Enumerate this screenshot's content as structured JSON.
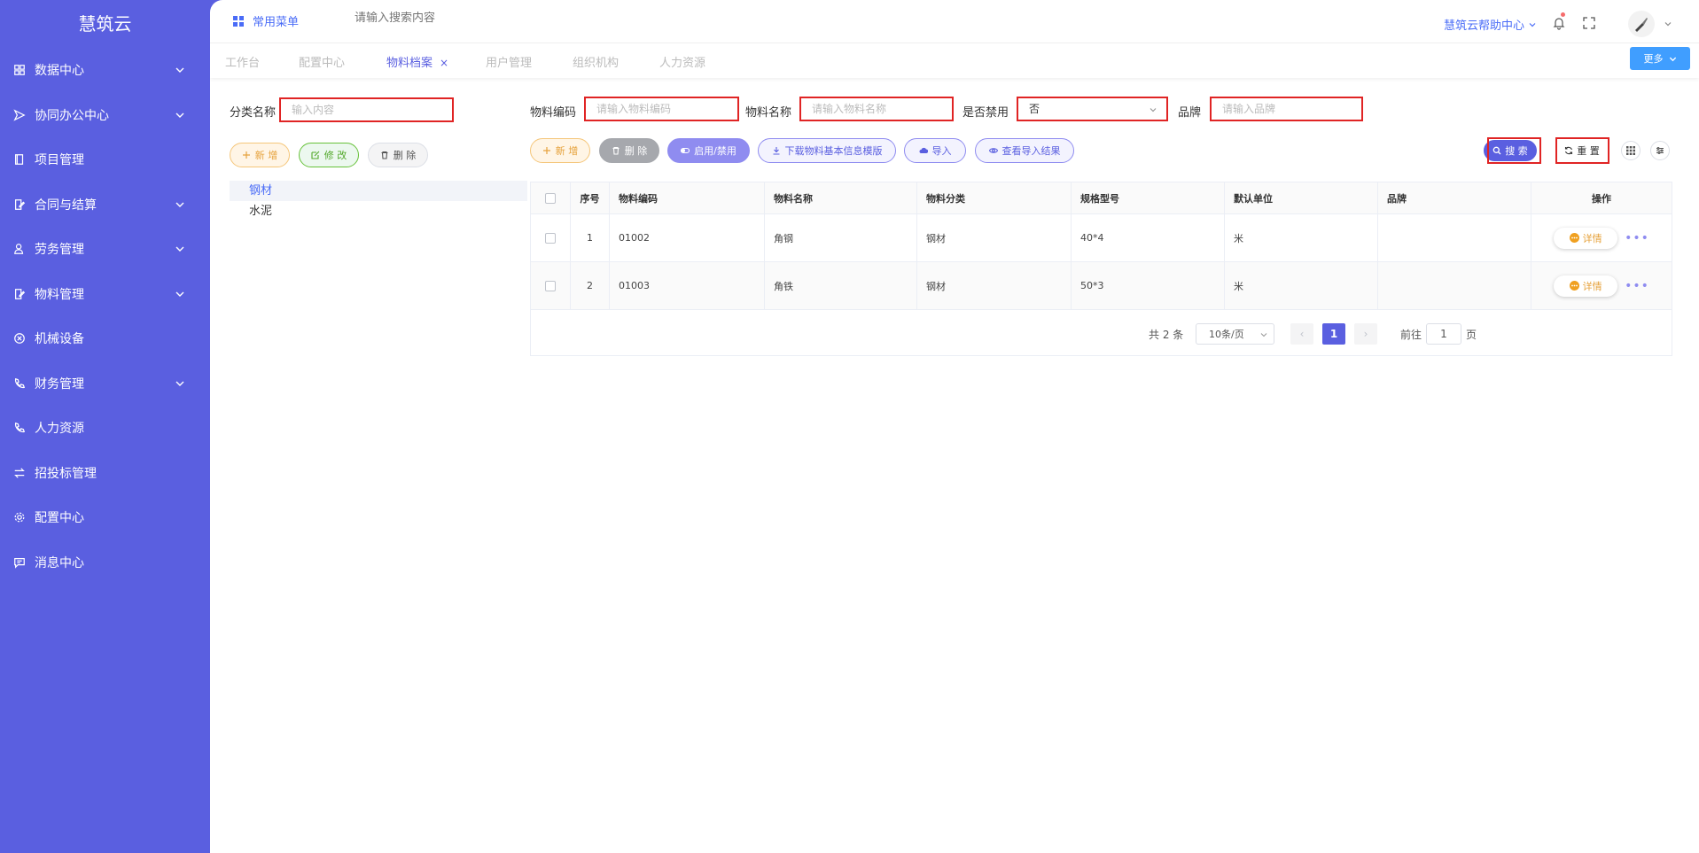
{
  "sidebar": {
    "brand": "慧筑云",
    "items": [
      {
        "label": "数据中心",
        "icon": "dashboard-icon",
        "expandable": true
      },
      {
        "label": "协同办公中心",
        "icon": "send-icon",
        "expandable": true
      },
      {
        "label": "项目管理",
        "icon": "book-icon",
        "expandable": false
      },
      {
        "label": "合同与结算",
        "icon": "edit-document-icon",
        "expandable": true
      },
      {
        "label": "劳务管理",
        "icon": "worker-icon",
        "expandable": true
      },
      {
        "label": "物料管理",
        "icon": "edit-document-icon",
        "expandable": true
      },
      {
        "label": "机械设备",
        "icon": "circle-x-icon",
        "expandable": false
      },
      {
        "label": "财务管理",
        "icon": "phone-icon",
        "expandable": true
      },
      {
        "label": "人力资源",
        "icon": "phone-icon",
        "expandable": false
      },
      {
        "label": "招投标管理",
        "icon": "exchange-icon",
        "expandable": false
      },
      {
        "label": "配置中心",
        "icon": "gear-icon",
        "expandable": false
      },
      {
        "label": "消息中心",
        "icon": "message-icon",
        "expandable": false
      }
    ]
  },
  "topbar": {
    "common_menu": "常用菜单",
    "search_placeholder": "请输入搜索内容",
    "help": "慧筑云帮助中心"
  },
  "tabs": {
    "items": [
      "工作台",
      "配置中心",
      "物料档案",
      "用户管理",
      "组织机构",
      "人力资源"
    ],
    "active_index": 2,
    "close": "×",
    "more": "更多"
  },
  "category": {
    "label": "分类名称",
    "placeholder": "输入内容",
    "add": "新 增",
    "edit": "修 改",
    "delete": "删 除",
    "tree": [
      "钢材",
      "水泥"
    ]
  },
  "filters": {
    "code_label": "物料编码",
    "code_placeholder": "请输入物料编码",
    "name_label": "物料名称",
    "name_placeholder": "请输入物料名称",
    "disabled_label": "是否禁用",
    "disabled_value": "否",
    "brand_label": "品牌",
    "brand_placeholder": "请输入品牌"
  },
  "toolbar": {
    "add": "新 增",
    "delete": "删 除",
    "toggle": "启用/禁用",
    "download": "下载物料基本信息模版",
    "import": "导入",
    "view_import": "查看导入结果",
    "search": "搜 索",
    "reset": "重 置"
  },
  "table": {
    "headers": [
      "序号",
      "物料编码",
      "物料名称",
      "物料分类",
      "规格型号",
      "默认单位",
      "品牌",
      "操作"
    ],
    "rows": [
      {
        "index": "1",
        "code": "01002",
        "name": "角钢",
        "category": "钢材",
        "spec": "40*4",
        "unit": "米",
        "brand": ""
      },
      {
        "index": "2",
        "code": "01003",
        "name": "角铁",
        "category": "钢材",
        "spec": "50*3",
        "unit": "米",
        "brand": ""
      }
    ],
    "detail_label": "详情",
    "more_dots": "•••"
  },
  "pagination": {
    "total": "共 2 条",
    "page_size": "10条/页",
    "current": "1",
    "goto_label": "前往",
    "goto_value": "1",
    "page_suffix": "页",
    "prev": "‹",
    "next": "›"
  },
  "colors": {
    "sidebar_bg": "#5a5fe0",
    "accent": "#5a5fe0",
    "highlight_frame": "#e02424",
    "more_button": "#409eff"
  }
}
